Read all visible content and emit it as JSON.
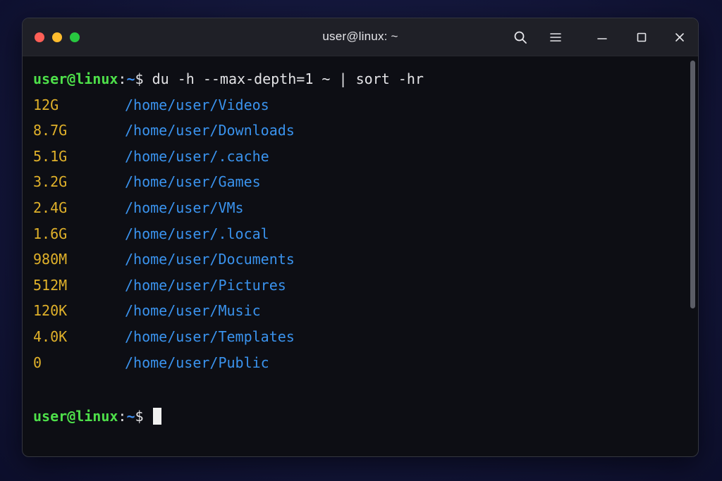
{
  "window": {
    "title": "user@linux: ~"
  },
  "titlebar": {
    "buttons": [
      "search-icon",
      "hamburger-menu-icon",
      "minimize-icon",
      "maximize-icon",
      "close-icon"
    ]
  },
  "terminal": {
    "prompt": {
      "user_host": "user@linux",
      "colon": ":",
      "path": "~",
      "dollar": "$"
    },
    "command": " du -h --max-depth=1 ~ | sort -hr",
    "output": [
      {
        "size": "12G",
        "path": "/home/user/Videos"
      },
      {
        "size": "8.7G",
        "path": "/home/user/Downloads"
      },
      {
        "size": "5.1G",
        "path": "/home/user/.cache"
      },
      {
        "size": "3.2G",
        "path": "/home/user/Games"
      },
      {
        "size": "2.4G",
        "path": "/home/user/VMs"
      },
      {
        "size": "1.6G",
        "path": "/home/user/.local"
      },
      {
        "size": "980M",
        "path": "/home/user/Documents"
      },
      {
        "size": "512M",
        "path": "/home/user/Pictures"
      },
      {
        "size": "120K",
        "path": "/home/user/Music"
      },
      {
        "size": "4.0K",
        "path": "/home/user/Templates"
      },
      {
        "size": "0",
        "path": "/home/user/Public"
      }
    ]
  },
  "colors": {
    "prompt_user": "#4ee04a",
    "prompt_path": "#3f8ff0",
    "size": "#e0b12a",
    "dirpath": "#3a93ee",
    "background": "#0d0e14"
  }
}
